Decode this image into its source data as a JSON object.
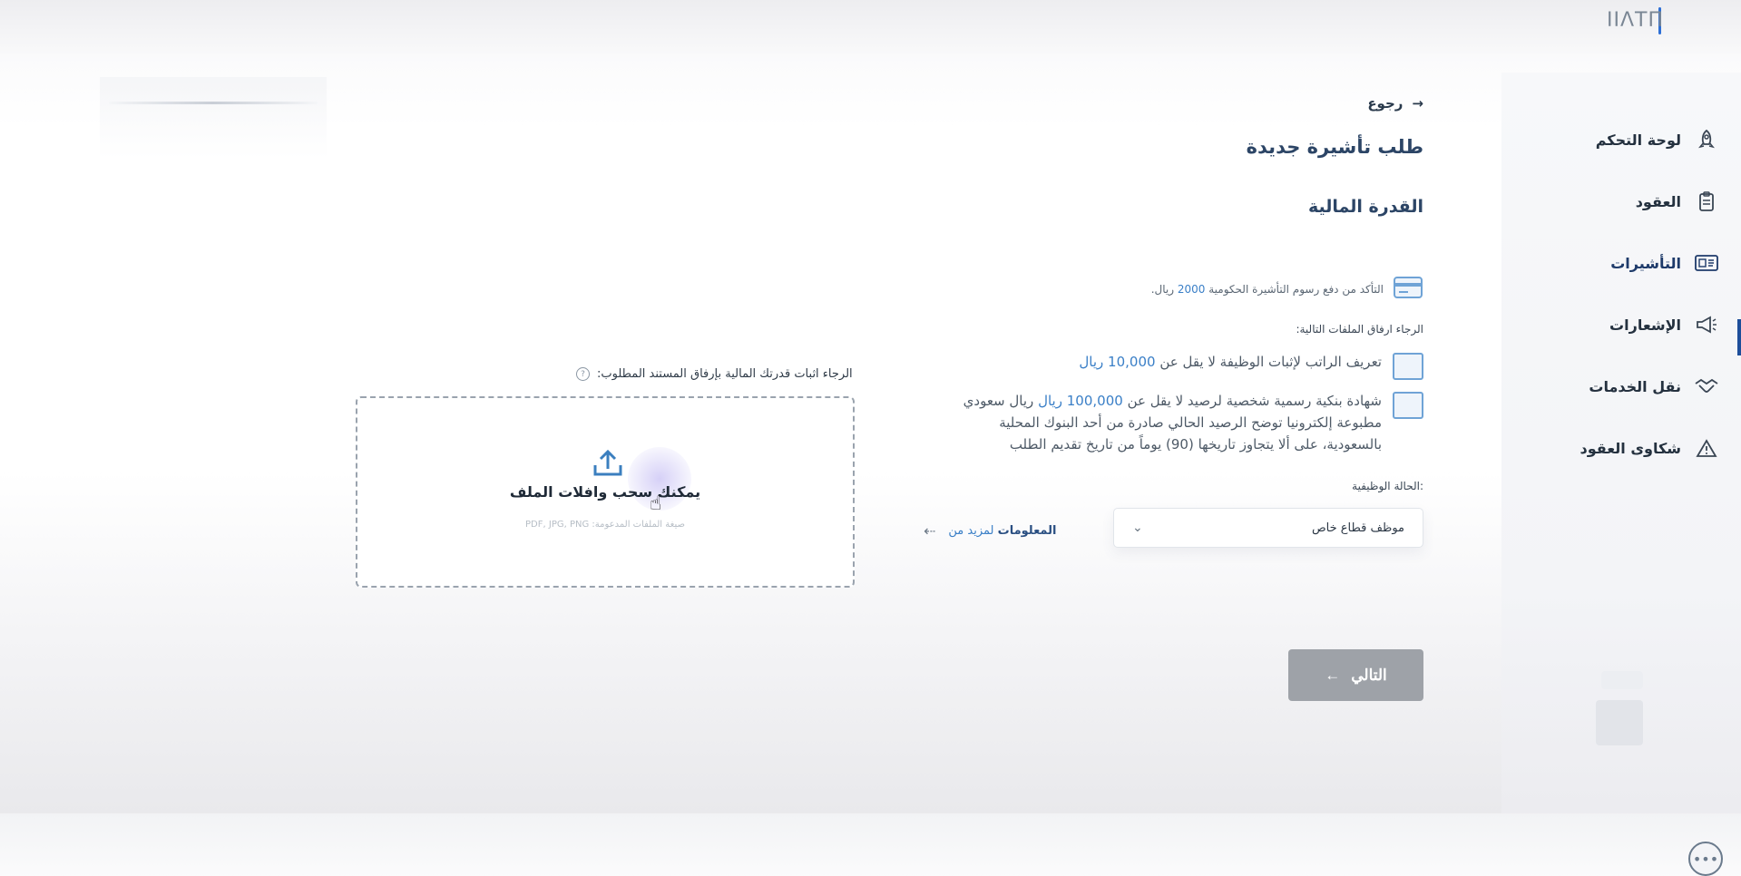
{
  "topbar": {
    "logo_text": "ΙΙΛΤΠ"
  },
  "sidebar": {
    "items": [
      {
        "label": "لوحة التحكم",
        "icon": "rocket-icon"
      },
      {
        "label": "العقود",
        "icon": "clipboard-icon"
      },
      {
        "label": "التأشيرات",
        "icon": "id-card-icon",
        "active": true
      },
      {
        "label": "الإشعارات",
        "icon": "megaphone-icon"
      },
      {
        "label": "نقل الخدمات",
        "icon": "handshake-icon"
      },
      {
        "label": "شكاوى العقود",
        "icon": "warning-icon"
      }
    ]
  },
  "main": {
    "back_label": "رجوع",
    "title": "طلب تأشيرة جديدة",
    "section_title": "القدرة المالية",
    "fee": {
      "pre": "التأكد من دفع رسوم التأشيرة الحكومية",
      "amount": "2000",
      "post": "ريال."
    },
    "attach_label": "الرجاء ارفاق الملفات التالية:",
    "documents": [
      {
        "pre": "تعريف الراتب لإثبات الوظيفة لا يقل عن",
        "amount": "10,000",
        "currency": "ريال",
        "post": "",
        "icon": "id-badge-icon"
      },
      {
        "pre": "شهادة بنكية رسمية شخصية لرصيد لا يقل عن",
        "amount": "100,000",
        "currency": "ريال",
        "post": "ريال سعودي",
        "line2": "مطبوعة إلكترونيا توضح الرصيد الحالي صادرة من أحد البنوك المحلية",
        "line3": "بالسعودية، على ألا يتجاوز تاريخها (90) يوماً من تاريخ تقديم الطلب",
        "icon": "document-icon"
      }
    ],
    "employment": {
      "label": "الحالة الوظيفية:",
      "value": "موظف قطاع خاص"
    },
    "more_info": {
      "prefix": "لمزيد من",
      "strong": "المعلومات"
    },
    "upload": {
      "label": "الرجاء اثبات قدرتك المالية بإرفاق المستند المطلوب:",
      "title": "يمكنك سحب وافلات الملف",
      "formats": "صيغة الملفات المدعومة: PDF, JPG, PNG"
    },
    "next_label": "التالي"
  },
  "colors": {
    "accent": "#3a7fc7",
    "nav_active": "#1d4e9a",
    "button_disabled": "#9ea2a8"
  }
}
